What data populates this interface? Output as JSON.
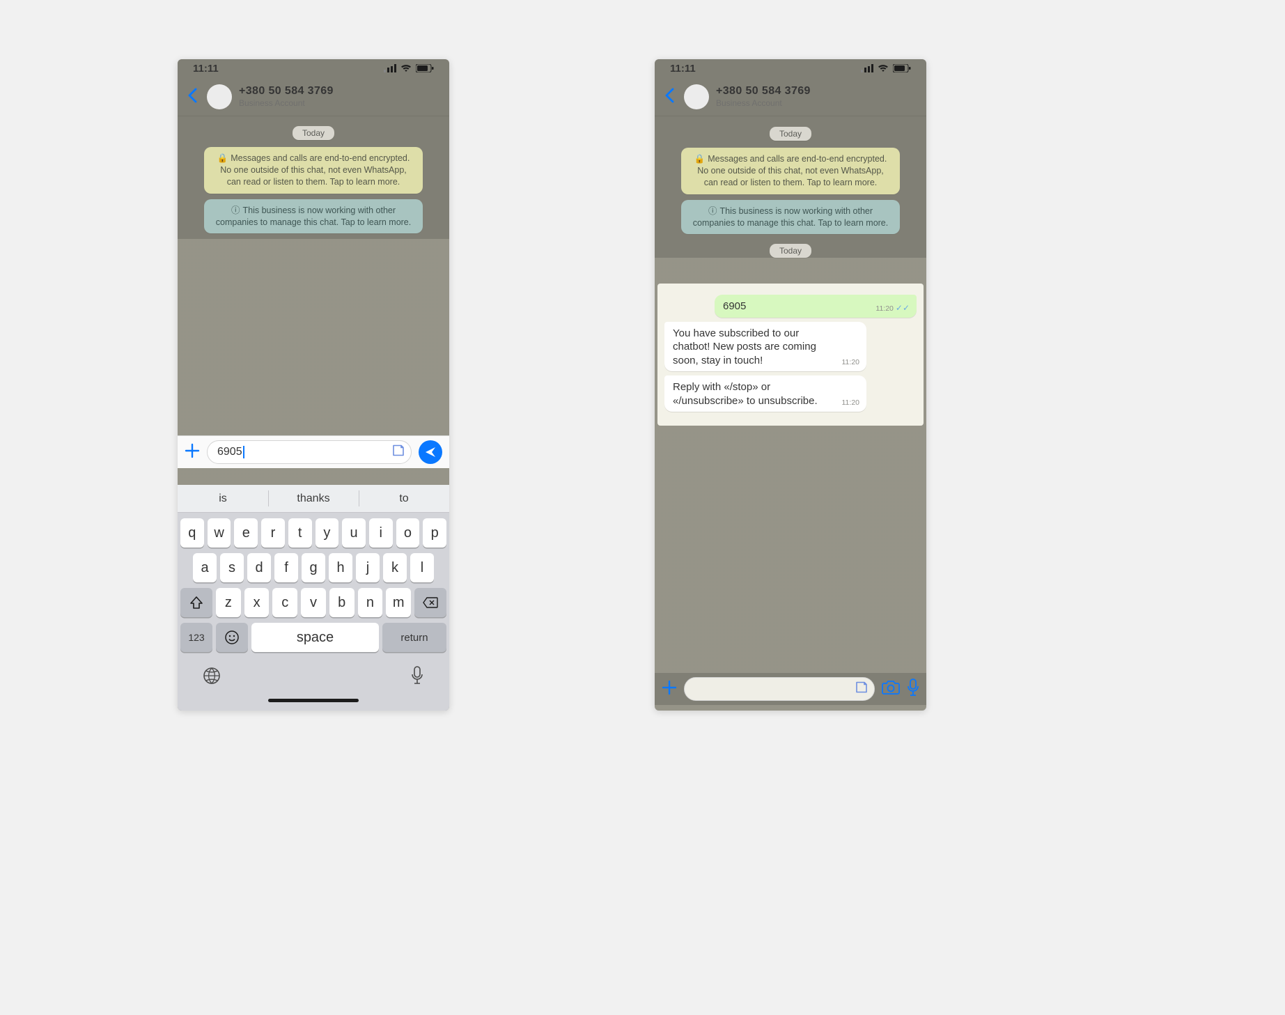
{
  "status": {
    "time": "11:11"
  },
  "header": {
    "title": "+380 50 584 3769",
    "subtitle": "Business Account"
  },
  "date_label": "Today",
  "encryption_banner": "Messages and calls are end-to-end encrypted. No one outside of this chat, not even WhatsApp, can read or listen to them. Tap to learn more.",
  "business_banner": "This business is now working with other companies to manage this chat. Tap to learn more.",
  "left": {
    "input_value": "6905",
    "predictions": [
      "is",
      "thanks",
      "to"
    ]
  },
  "right": {
    "sent_message": {
      "text": "6905",
      "time": "11:20"
    },
    "msg1": {
      "text": "You have subscribed to our chatbot! New posts are coming soon, stay in touch!",
      "time": "11:20"
    },
    "msg2": {
      "text": "Reply with «/stop» or «/unsubscribe» to unsubscribe.",
      "time": "11:20"
    }
  },
  "keyboard": {
    "row1": [
      "q",
      "w",
      "e",
      "r",
      "t",
      "y",
      "u",
      "i",
      "o",
      "p"
    ],
    "row2": [
      "a",
      "s",
      "d",
      "f",
      "g",
      "h",
      "j",
      "k",
      "l"
    ],
    "row3": [
      "z",
      "x",
      "c",
      "v",
      "b",
      "n",
      "m"
    ],
    "n123": "123",
    "space": "space",
    "return": "return"
  }
}
